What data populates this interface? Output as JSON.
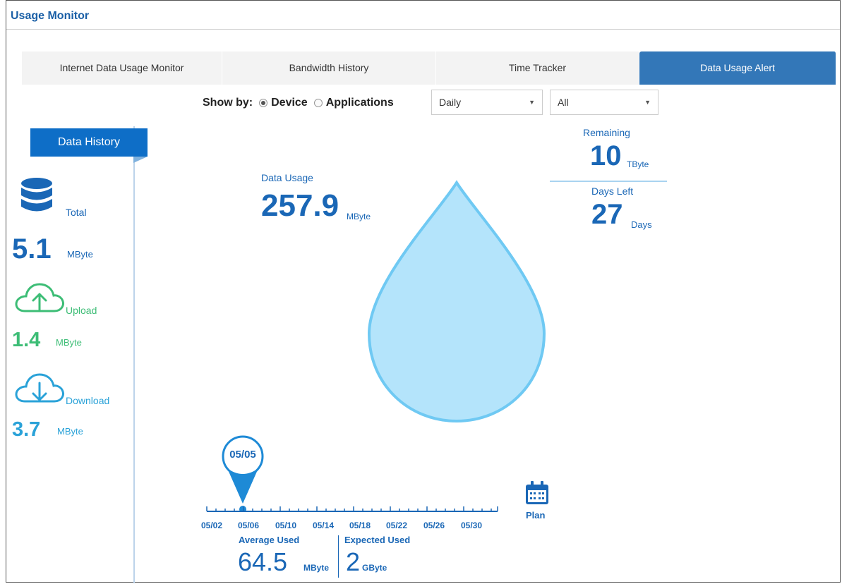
{
  "window": {
    "title": "Usage Monitor"
  },
  "tabs": [
    {
      "label": "Internet Data Usage Monitor"
    },
    {
      "label": "Bandwidth History"
    },
    {
      "label": "Time Tracker"
    },
    {
      "label": "Data Usage Alert"
    }
  ],
  "filter": {
    "show_by_label": "Show by:",
    "device_label": "Device",
    "applications_label": "Applications",
    "selected": "Device",
    "period_value": "Daily",
    "scope_value": "All"
  },
  "sidebar": {
    "history_button": "Data History",
    "total": {
      "label": "Total",
      "value": "5.1",
      "unit": "MByte"
    },
    "upload": {
      "label": "Upload",
      "value": "1.4",
      "unit": "MByte"
    },
    "download": {
      "label": "Download",
      "value": "3.7",
      "unit": "MByte"
    }
  },
  "usage": {
    "label": "Data Usage",
    "value": "257.9",
    "unit": "MByte"
  },
  "remaining": {
    "label": "Remaining",
    "value": "10",
    "unit": "TByte"
  },
  "days_left": {
    "label": "Days Left",
    "value": "27",
    "unit": "Days"
  },
  "timeline": {
    "marker": "05/05",
    "ticks": [
      "05/02",
      "05/06",
      "05/10",
      "05/14",
      "05/18",
      "05/22",
      "05/26",
      "05/30"
    ],
    "average_label": "Average Used",
    "average_value": "64.5",
    "average_unit": "MByte",
    "expected_label": "Expected Used",
    "expected_value": "2",
    "expected_unit": "GByte"
  },
  "plan": {
    "label": "Plan"
  },
  "colors": {
    "accent": "#3377b8",
    "drop_fill": "#b4e4fb",
    "drop_stroke": "#6fc9f3",
    "upload": "#3dbd76",
    "download": "#2aa2d8"
  },
  "icons": [
    "database-icon",
    "cloud-upload-icon",
    "cloud-download-icon",
    "location-pin-icon",
    "calendar-icon",
    "water-drop-icon"
  ]
}
